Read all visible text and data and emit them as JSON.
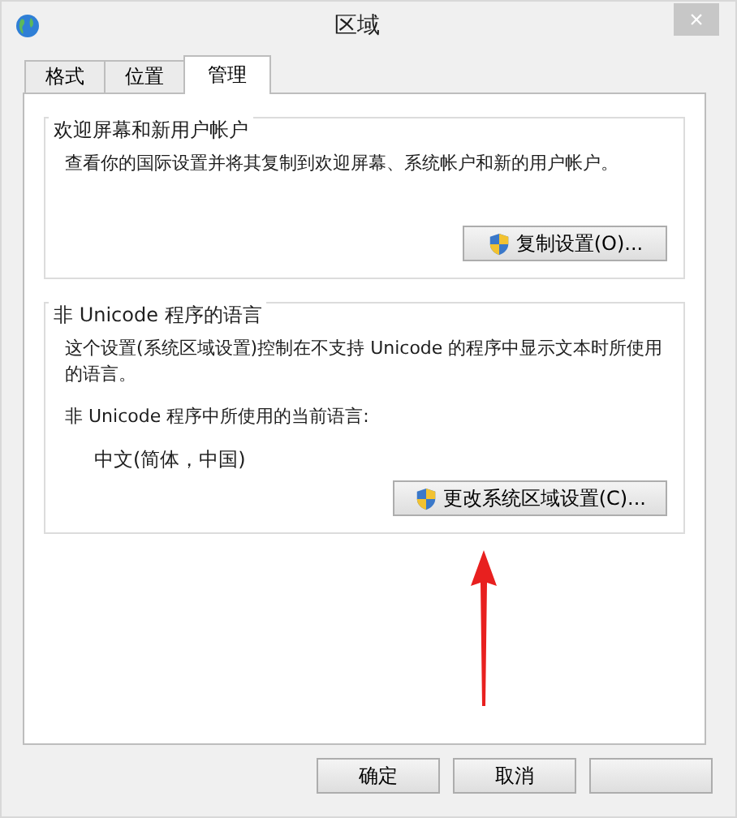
{
  "window": {
    "title": "区域",
    "close": "×"
  },
  "tabs": [
    {
      "label": "格式",
      "selected": false
    },
    {
      "label": "位置",
      "selected": false
    },
    {
      "label": "管理",
      "selected": true
    }
  ],
  "groups": [
    {
      "title": "欢迎屏幕和新用户帐户",
      "lines": [
        "查看你的国际设置并将其复制到欢迎屏幕、系统帐户和新的用户帐户。"
      ],
      "button": "复制设置(O)..."
    },
    {
      "title": "非 Unicode 程序的语言",
      "lines": [
        "这个设置(系统区域设置)控制在不支持 Unicode 的程序中显示文本时所使用的语言。",
        "非 Unicode 程序中所使用的当前语言:"
      ],
      "value": "中文(简体，中国)",
      "button": "更改系统区域设置(C)..."
    }
  ],
  "buttons": [
    {
      "kind": "labeled",
      "label": "确定"
    },
    {
      "kind": "labeled",
      "label": "取消"
    },
    {
      "kind": "covered"
    }
  ],
  "annotation": {
    "kind": "arrow"
  }
}
